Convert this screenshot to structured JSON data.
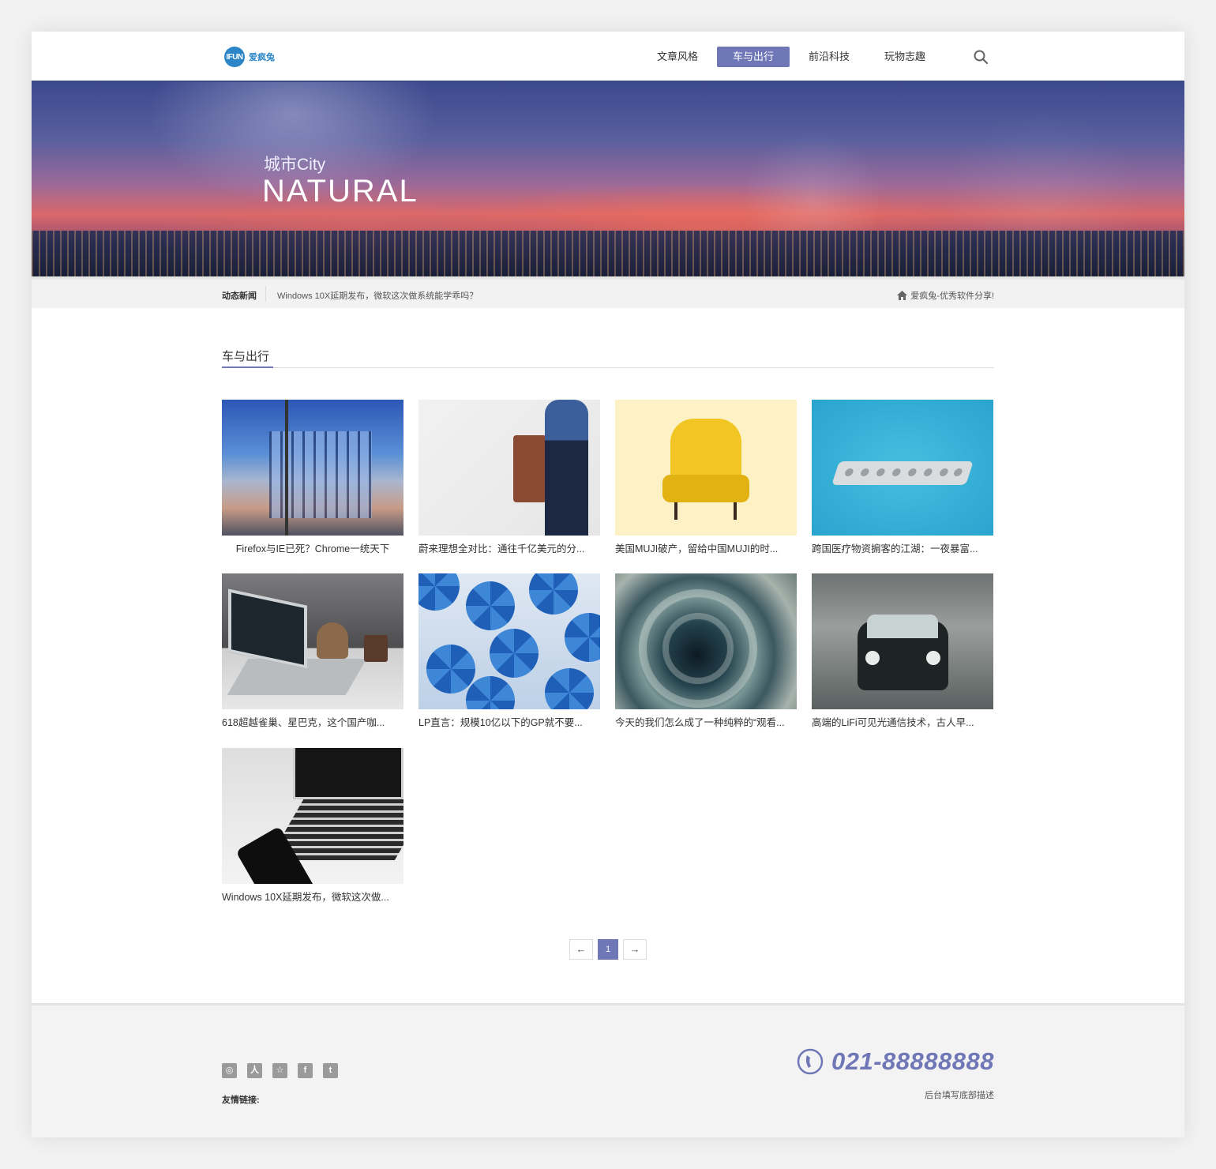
{
  "header": {
    "logo_mark": "IFUN",
    "logo_text": "爱疯兔",
    "nav": [
      {
        "label": "文章风格",
        "active": false
      },
      {
        "label": "车与出行",
        "active": true
      },
      {
        "label": "前沿科技",
        "active": false
      },
      {
        "label": "玩物志趣",
        "active": false
      }
    ],
    "search_icon": "search-icon"
  },
  "banner": {
    "subtitle": "城市City",
    "title": "NATURAL"
  },
  "ticker": {
    "label": "动态新闻",
    "news": "Windows 10X延期发布，微软这次做系统能学乖吗？",
    "right_text": "爱疯兔-优秀软件分享!",
    "right_icon": "home-icon"
  },
  "section": {
    "title": "车与出行"
  },
  "articles": [
    {
      "title": "Firefox与IE已死？Chrome一统天下"
    },
    {
      "title": "蔚来理想全对比：通往千亿美元的分..."
    },
    {
      "title": "美国MUJI破产，留给中国MUJI的时..."
    },
    {
      "title": "跨国医疗物资掮客的江湖：一夜暴富..."
    },
    {
      "title": "618超越雀巢、星巴克，这个国产咖..."
    },
    {
      "title": "LP直言：规模10亿以下的GP就不要..."
    },
    {
      "title": "今天的我们怎么成了一种纯粹的“观看..."
    },
    {
      "title": "高端的LiFi可见光通信技术，古人早..."
    },
    {
      "title": "Windows 10X延期发布，微软这次做..."
    }
  ],
  "pagination": {
    "prev": "←",
    "current": "1",
    "next": "→"
  },
  "footer": {
    "social_icons": [
      "weibo-icon",
      "renren-icon",
      "star-icon",
      "facebook-icon",
      "twitter-icon"
    ],
    "social_glyphs": [
      "◎",
      "人",
      "☆",
      "f",
      "t"
    ],
    "links_label": "友情链接:",
    "phone": "021-88888888",
    "description": "后台填写底部描述"
  },
  "colors": {
    "accent": "#6f77b6",
    "brand": "#2b85c6",
    "header_border": "#3b4a86"
  }
}
